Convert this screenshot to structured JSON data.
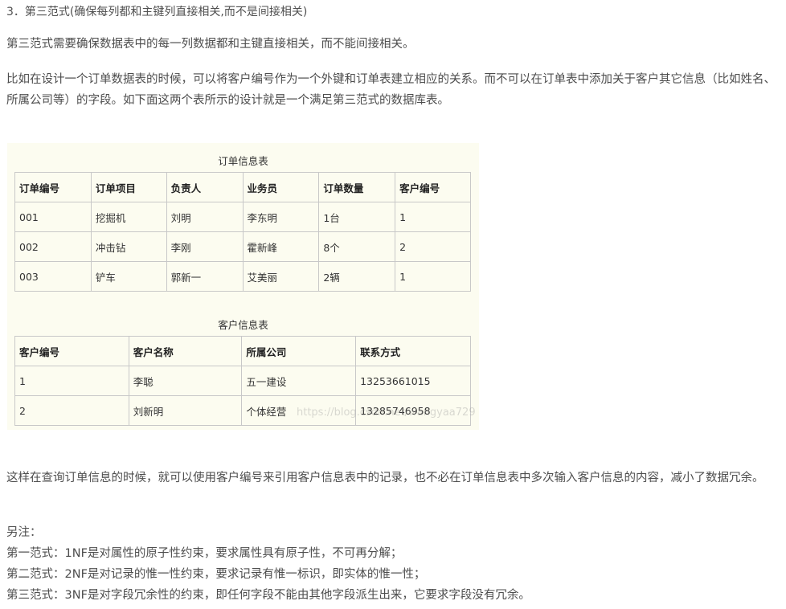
{
  "heading": "3．第三范式(确保每列都和主键列直接相关,而不是间接相关)",
  "intro": "第三范式需要确保数据表中的每一列数据都和主键直接相关，而不能间接相关。",
  "example": "比如在设计一个订单数据表的时候，可以将客户编号作为一个外键和订单表建立相应的关系。而不可以在订单表中添加关于客户其它信息（比如姓名、所属公司等）的字段。如下面这两个表所示的设计就是一个满足第三范式的数据库表。",
  "order_table": {
    "caption": "订单信息表",
    "headers": [
      "订单编号",
      "订单项目",
      "负责人",
      "业务员",
      "订单数量",
      "客户编号"
    ],
    "rows": [
      [
        "001",
        "挖掘机",
        "刘明",
        "李东明",
        "1台",
        "1"
      ],
      [
        "002",
        "冲击钻",
        "李刚",
        "霍新峰",
        "8个",
        "2"
      ],
      [
        "003",
        "铲车",
        "郭新一",
        "艾美丽",
        "2辆",
        "1"
      ]
    ]
  },
  "customer_table": {
    "caption": "客户信息表",
    "headers": [
      "客户编号",
      "客户名称",
      "所属公司",
      "联系方式"
    ],
    "rows": [
      [
        "1",
        "李聪",
        "五一建设",
        "13253661015"
      ],
      [
        "2",
        "刘新明",
        "个体经营",
        "13285746958"
      ]
    ]
  },
  "watermark": "https://blog.csdn.net/wangyaa729",
  "conclusion": "这样在查询订单信息的时候，就可以使用客户编号来引用客户信息表中的记录，也不必在订单信息表中多次输入客户信息的内容，减小了数据冗余。",
  "notes": {
    "title": "另注：",
    "nf1": "第一范式：1NF是对属性的原子性约束，要求属性具有原子性，不可再分解；",
    "nf2": "第二范式：2NF是对记录的惟一性约束，要求记录有惟一标识，即实体的惟一性；",
    "nf3": "第三范式：3NF是对字段冗余性的约束，即任何字段不能由其他字段派生出来，它要求字段没有冗余。"
  }
}
